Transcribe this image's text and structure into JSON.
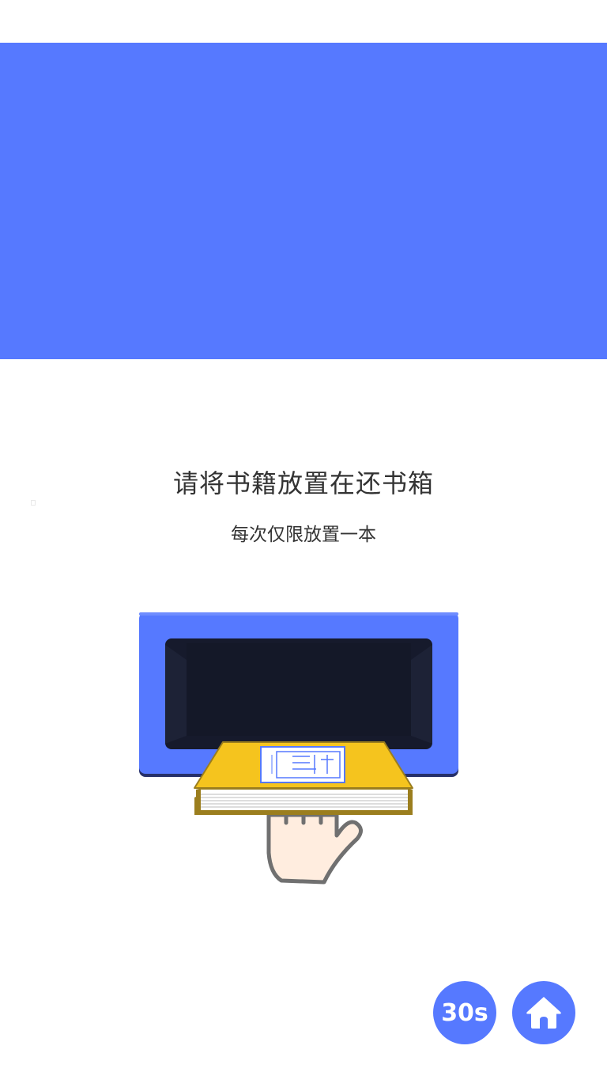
{
  "colors": {
    "accent": "#5679FF",
    "slot_dark": "#161A2C",
    "book_yellow": "#F5C41E",
    "hand_fill": "#FFEDDF"
  },
  "instructions": {
    "title": "请将书籍放置在还书箱",
    "subtitle": "每次仅限放置一本"
  },
  "controls": {
    "timer_label": "30s",
    "home_icon": "home-icon"
  }
}
